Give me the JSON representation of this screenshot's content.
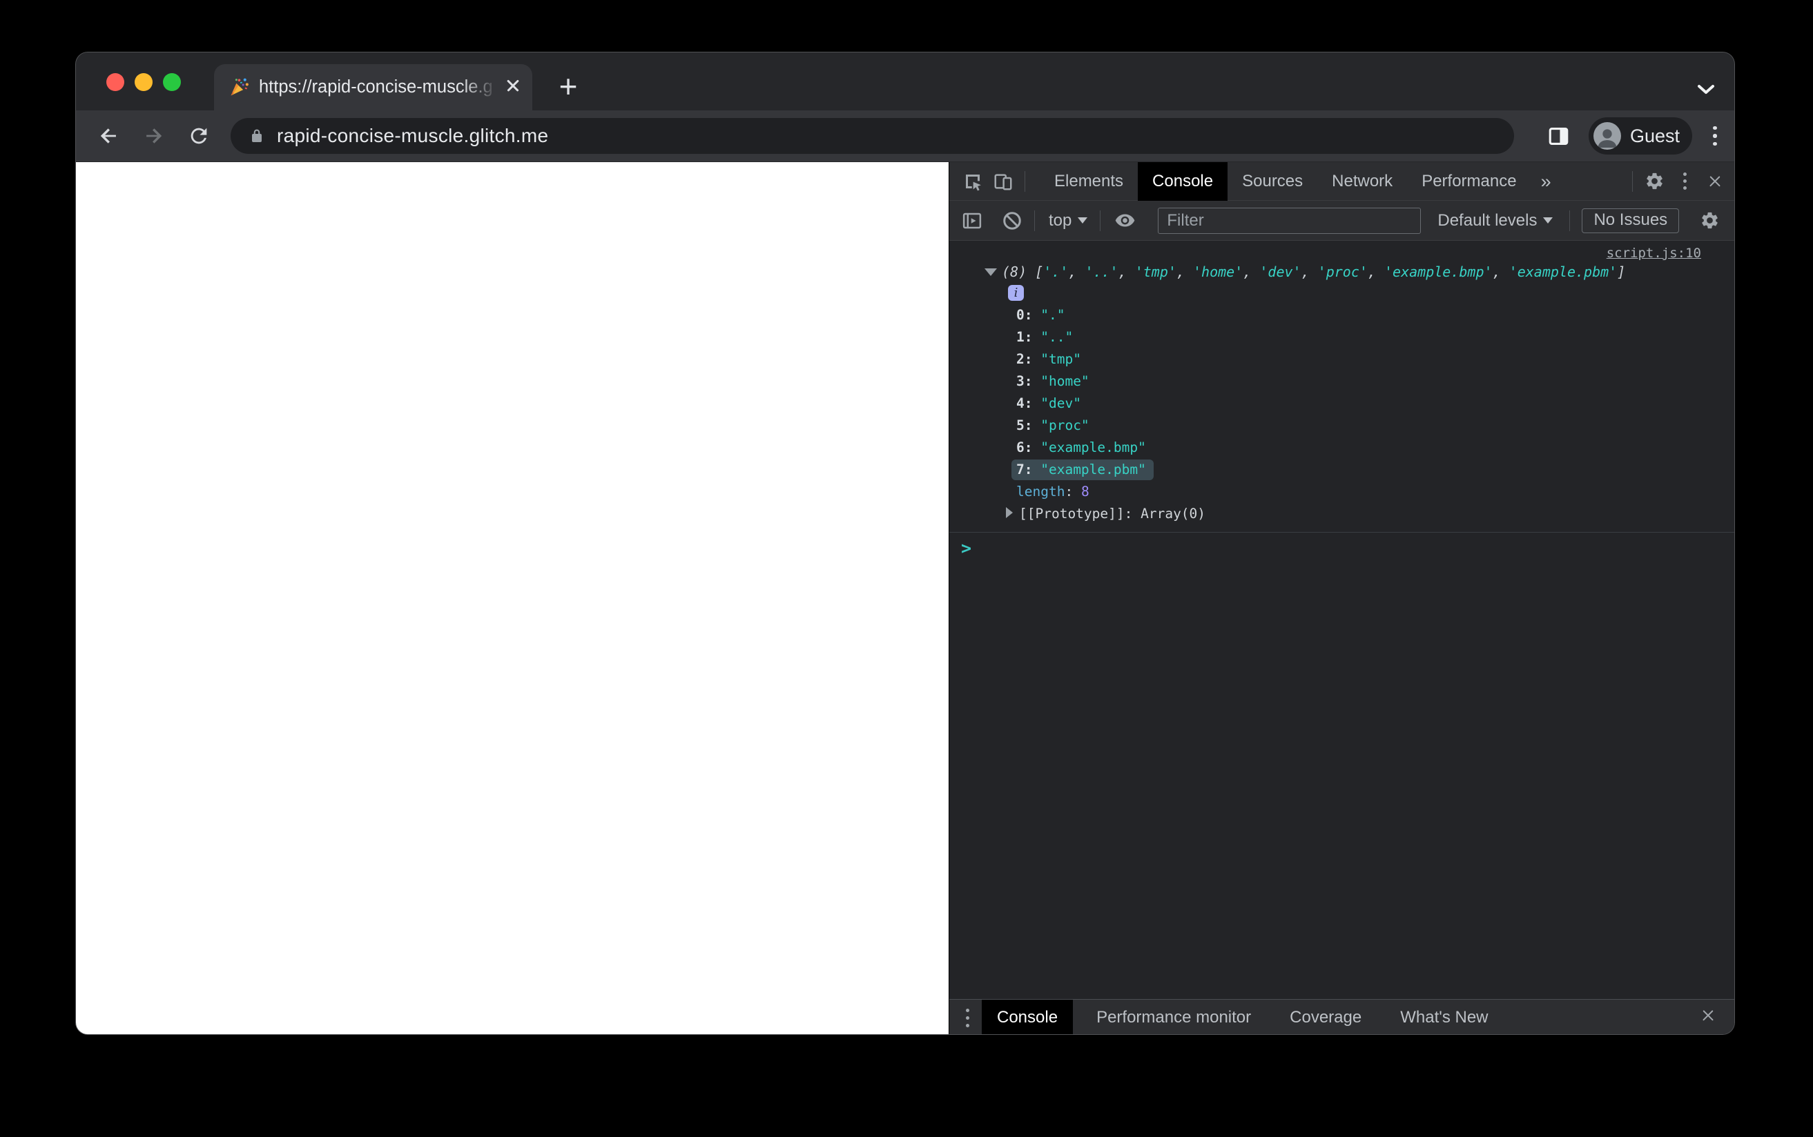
{
  "browser": {
    "tab": {
      "title": "https://rapid-concise-muscle.g",
      "favicon": "party-popper-icon"
    },
    "new_tab_label": "+",
    "address_bar": {
      "url": "rapid-concise-muscle.glitch.me"
    },
    "profile_label": "Guest"
  },
  "devtools": {
    "tabbar": {
      "tabs": [
        "Elements",
        "Console",
        "Sources",
        "Network",
        "Performance"
      ],
      "active": "Console",
      "overflow_label": "»"
    },
    "toolbar": {
      "context_label": "top",
      "filter_placeholder": "Filter",
      "levels_label": "Default levels",
      "issues_label": "No Issues"
    },
    "console": {
      "source_link": "script.js:10",
      "preview_count": "(8)",
      "items": [
        ".",
        "..",
        "tmp",
        "home",
        "dev",
        "proc",
        "example.bmp",
        "example.pbm"
      ],
      "highlighted_index": 7,
      "info_badge": "i",
      "length_label": "length",
      "length_value": "8",
      "prototype_label": "[[Prototype]]",
      "prototype_value": "Array(0)",
      "prompt_symbol": ">"
    },
    "drawer": {
      "tabs": [
        "Console",
        "Performance monitor",
        "Coverage",
        "What's New"
      ],
      "active": "Console"
    }
  },
  "icons": {
    "window": [
      "close-button",
      "minimize-button",
      "zoom-button",
      "chevron-down-icon",
      "new-tab-plus-icon",
      "tab-close-icon",
      "party-popper-icon"
    ],
    "toolbar": [
      "back-icon",
      "forward-icon",
      "reload-icon",
      "lock-icon",
      "side-panel-icon",
      "avatar-icon",
      "kebab-menu-icon"
    ],
    "devtools": [
      "inspect-element-icon",
      "device-toolbar-icon",
      "settings-gear-icon",
      "kebab-menu-icon",
      "close-icon",
      "console-sidebar-icon",
      "clear-console-icon",
      "eye-icon",
      "expand-caret-icon",
      "info-icon",
      "collapsed-caret-icon",
      "prompt-chevron-icon"
    ]
  },
  "colors": {
    "string": "#38d3c6",
    "property_name": "#5db0d7",
    "number": "#9e8cfc",
    "info_badge_bg": "#a9b0f5",
    "row_highlight": "#3b4a52",
    "active_tab_bg": "#000000",
    "devtools_chrome_bg": "#2d2e31",
    "console_bg": "#232427",
    "browser_chrome_bg": "#35363a",
    "traffic_red": "#ff5f57",
    "traffic_yellow": "#febc2e",
    "traffic_green": "#28c840"
  }
}
